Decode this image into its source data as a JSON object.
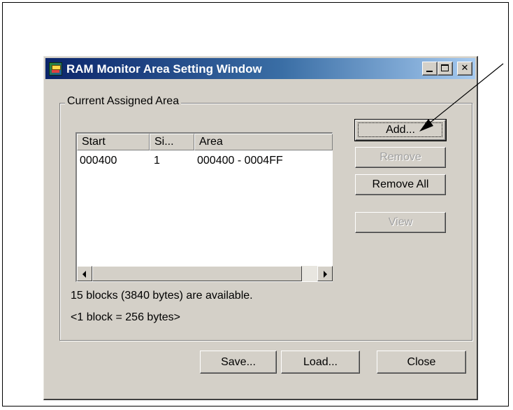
{
  "window": {
    "title": "RAM Monitor Area Setting Window",
    "minimize_glyph": "_",
    "maximize_glyph": "□",
    "close_glyph": "✕"
  },
  "group": {
    "label": "Current Assigned Area"
  },
  "list": {
    "columns": [
      "Start",
      "Si...",
      "Area"
    ],
    "rows": [
      {
        "start": "000400",
        "size": "1",
        "area": "000400 - 0004FF"
      }
    ]
  },
  "buttons": {
    "add": "Add...",
    "remove": "Remove",
    "remove_all": "Remove All",
    "view": "View",
    "save": "Save...",
    "load": "Load...",
    "close": "Close"
  },
  "info": {
    "line1": "15 blocks (3840 bytes) are available.",
    "line2": "<1 block = 256 bytes>"
  },
  "icons": {
    "app": "ram-monitor-app-icon",
    "scroll_left": "scroll-left-arrow",
    "scroll_right": "scroll-right-arrow"
  }
}
